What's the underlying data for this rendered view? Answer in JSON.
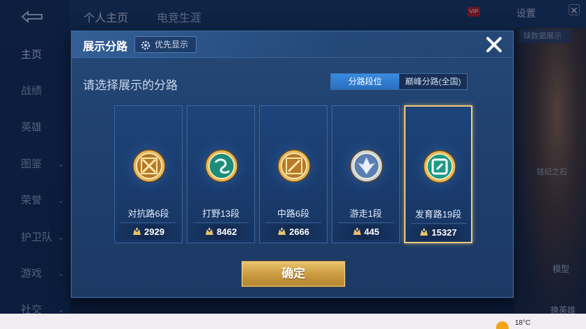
{
  "background": {
    "back_icon": "back-arrow-icon",
    "top_tabs": [
      "个人主页",
      "电竞生涯"
    ],
    "settings_label": "设置",
    "vip_label": "VIP",
    "sidebar_items": [
      {
        "label": "主页",
        "chevron": false,
        "active": true
      },
      {
        "label": "战绩",
        "chevron": false,
        "active": false
      },
      {
        "label": "英雄",
        "chevron": false,
        "active": false
      },
      {
        "label": "图鉴",
        "chevron": true,
        "active": false
      },
      {
        "label": "荣誉",
        "chevron": true,
        "active": false
      },
      {
        "label": "护卫队",
        "chevron": true,
        "active": false
      },
      {
        "label": "游戏",
        "chevron": true,
        "active": false
      },
      {
        "label": "社交",
        "chevron": true,
        "active": false
      }
    ],
    "right_labels": {
      "pill": "球数据展示",
      "stone": "铭纪之石",
      "model": "模型",
      "change_hero": "换英雄"
    }
  },
  "modal": {
    "title": "展示分路",
    "priority_button": "优先显示",
    "subtitle": "请选择展示的分路",
    "segments": [
      {
        "label": "分路段位",
        "active": true
      },
      {
        "label": "巅峰分路(全国)",
        "active": false
      }
    ],
    "cards": [
      {
        "name": "对抗路6段",
        "score": "2929",
        "emblem": "clash-lane-emblem-icon",
        "rim": "#e6b95c",
        "core": "#b57a2a",
        "selected": false
      },
      {
        "name": "打野13段",
        "score": "8462",
        "emblem": "jungle-emblem-icon",
        "rim": "#e6b95c",
        "core": "#1f8c7a",
        "selected": false
      },
      {
        "name": "中路6段",
        "score": "2666",
        "emblem": "mid-lane-emblem-icon",
        "rim": "#e6b95c",
        "core": "#b57a2a",
        "selected": false
      },
      {
        "name": "游走1段",
        "score": "445",
        "emblem": "roam-emblem-icon",
        "rim": "#c9d6e6",
        "core": "#5b7fb0",
        "selected": false
      },
      {
        "name": "发育路19段",
        "score": "15327",
        "emblem": "farm-lane-emblem-icon",
        "rim": "#e6b95c",
        "core": "#1f9a86",
        "selected": true
      }
    ],
    "confirm_button": "确定"
  },
  "taskbar": {
    "temperature": "18°C",
    "weather_icon": "sun-icon"
  },
  "colors": {
    "accent_gold": "#e8c26a",
    "accent_blue": "#2f7fd6",
    "panel": "#214473"
  }
}
